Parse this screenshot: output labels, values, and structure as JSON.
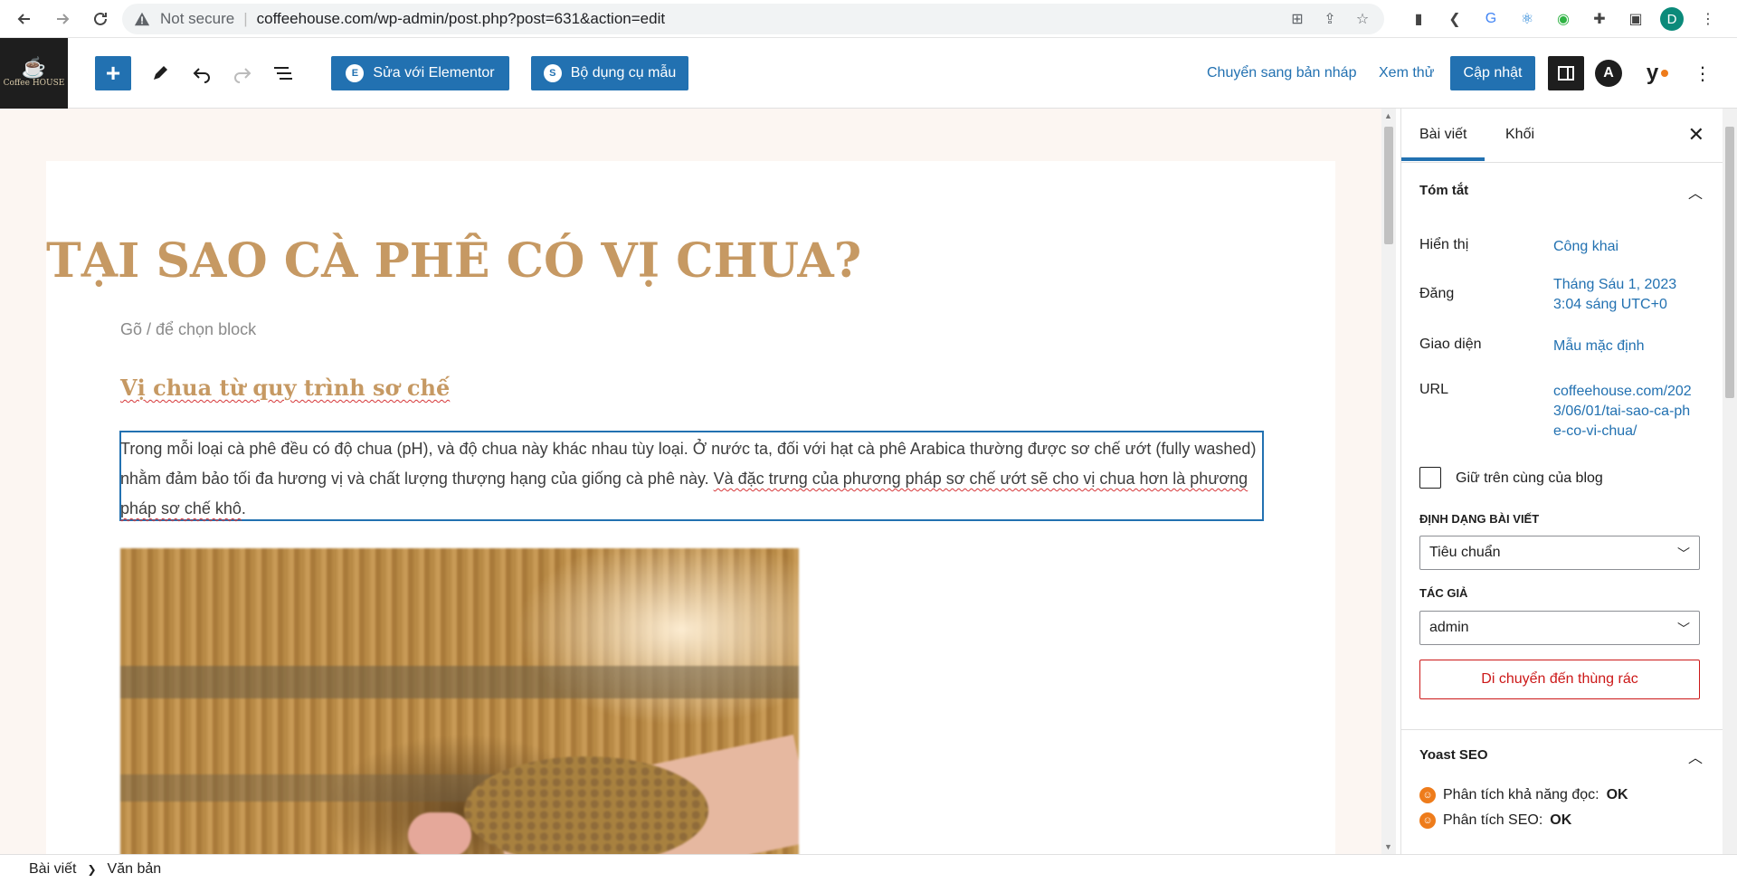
{
  "browser": {
    "not_secure": "Not secure",
    "url": "coffeehouse.com/wp-admin/post.php?post=631&action=edit",
    "avatar_letter": "D"
  },
  "topbar": {
    "logo_text": "Coffee HOUSE",
    "elementor_label": "Sửa với Elementor",
    "template_label": "Bộ dụng cụ mẫu",
    "draft_label": "Chuyển sang bản nháp",
    "preview_label": "Xem thử",
    "update_label": "Cập nhật"
  },
  "post": {
    "title": "TẠI SAO CÀ PHÊ CÓ VỊ CHUA?",
    "placeholder": "Gõ / để chọn block",
    "heading": "Vị chua từ quy trình sơ chế",
    "para_plain": "Trong mỗi loại cà phê đều có độ chua (pH), và độ chua này khác nhau tùy loại. Ở nước ta, đối với hạt cà phê Arabica thường được sơ chế ướt (fully washed) nhằm đảm bảo tối đa hương vị và chất lượng thượng hạng của giống cà phê này. ",
    "para_marked": "Và đặc trưng của phương pháp sơ chế ướt sẽ cho vị chua hơn là phương pháp sơ chế khô",
    "para_end": "."
  },
  "sidebar": {
    "tab_post": "Bài viết",
    "tab_block": "Khối",
    "summary_title": "Tóm tắt",
    "visibility_label": "Hiển thị",
    "visibility_value": "Công khai",
    "publish_label": "Đăng",
    "publish_value": "Tháng Sáu 1, 2023 3:04 sáng UTC+0",
    "template_label": "Giao diện",
    "template_value": "Mẫu mặc định",
    "url_label": "URL",
    "url_value": "coffeehouse.com/2023/06/01/tai-sao-ca-phe-co-vi-chua/",
    "sticky_label": "Giữ trên cùng của blog",
    "format_label": "ĐỊNH DẠNG BÀI VIẾT",
    "format_value": "Tiêu chuẩn",
    "author_label": "TÁC GIẢ",
    "author_value": "admin",
    "trash_label": "Di chuyển đến thùng rác",
    "yoast_title": "Yoast SEO",
    "readability_label": "Phân tích khả năng đọc:",
    "readability_value": "OK",
    "seo_label": "Phân tích SEO:",
    "seo_value": "OK"
  },
  "footer": {
    "crumb1": "Bài viết",
    "crumb2": "Văn bản"
  },
  "colors": {
    "accent": "#2271b1",
    "title": "#c69963",
    "danger": "#cc1818",
    "yoast_ok": "#ee7c1b"
  }
}
